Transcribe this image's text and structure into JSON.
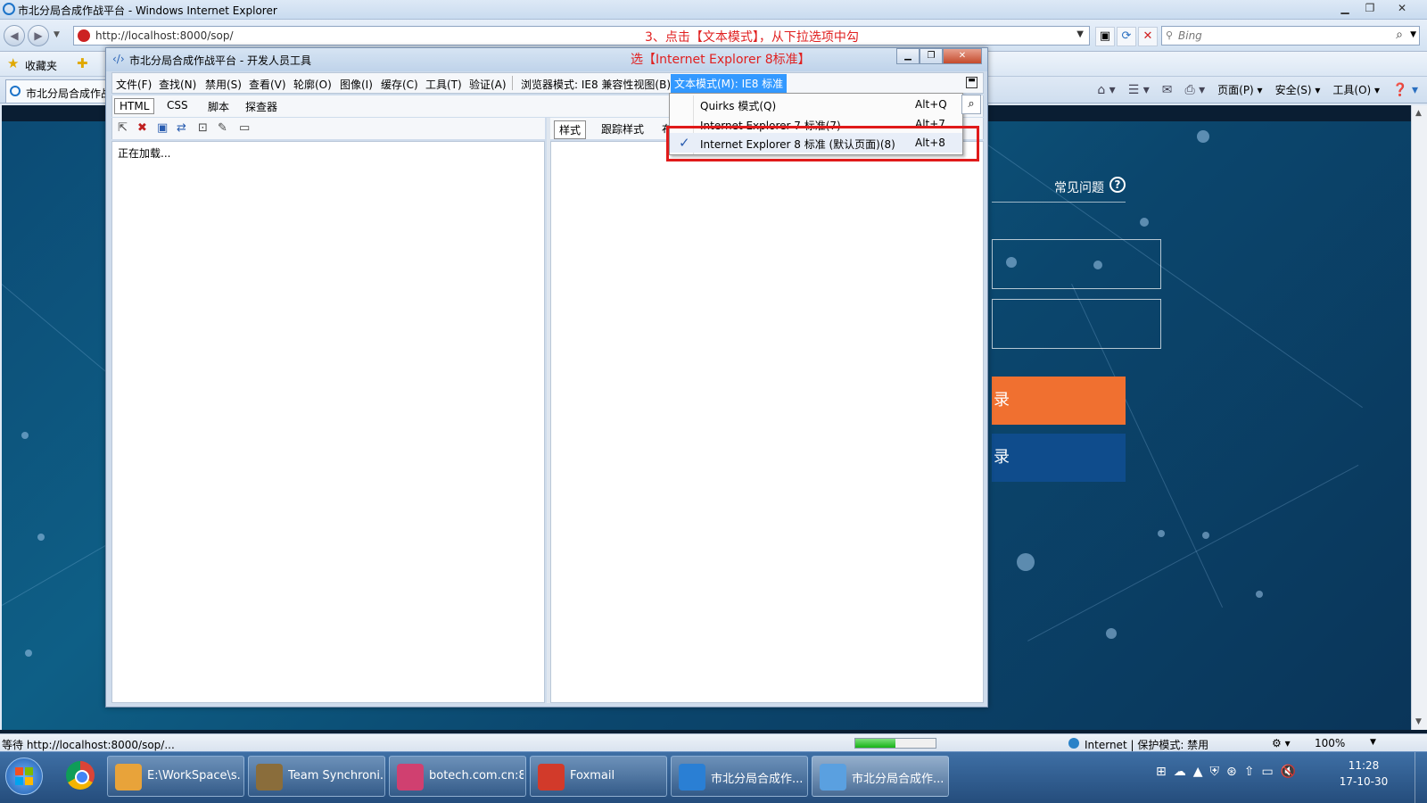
{
  "ie": {
    "window_title": "市北分局合成作战平台 - Windows Internet Explorer",
    "url": "http://localhost:8000/sop/",
    "search_placeholder": "Bing",
    "favorites_label": "收藏夹",
    "tab_label": "市北分局合成作战平台",
    "commands": [
      "页面(P) ▾",
      "安全(S) ▾",
      "工具(O) ▾"
    ],
    "status_text": "等待 http://localhost:8000/sop/...",
    "progress_percent": 50,
    "zone_text": "Internet | 保护模式: 禁用",
    "zoom": "100%"
  },
  "annotations": {
    "step_line1": "3、点击【文本模式】，从下拉选项中勾",
    "step_line2": "选【Internet Explorer 8标准】"
  },
  "page": {
    "faq": "常见问题",
    "login_btn1": "录",
    "login_btn2": "录"
  },
  "devtools": {
    "title": "市北分局合成作战平台 - 开发人员工具",
    "menu": [
      "文件(F)",
      "查找(N)",
      "禁用(S)",
      "查看(V)",
      "轮廓(O)",
      "图像(I)",
      "缓存(C)",
      "工具(T)",
      "验证(A)",
      "浏览器模式: IE8 兼容性视图(B)"
    ],
    "text_mode_menu": "文本模式(M): IE8 标准",
    "tabs": [
      "HTML",
      "CSS",
      "脚本",
      "探查器"
    ],
    "loading": "正在加载...",
    "right_tabs": [
      "样式",
      "跟踪样式",
      "布"
    ],
    "dropdown": [
      {
        "label": "Quirks 模式(Q)",
        "shortcut": "Alt+Q",
        "checked": false
      },
      {
        "label": "Internet Explorer 7 标准(7)",
        "shortcut": "Alt+7",
        "checked": false
      },
      {
        "label": "Internet Explorer 8 标准 (默认页面)(8)",
        "shortcut": "Alt+8",
        "checked": true
      }
    ]
  },
  "taskbar": {
    "items": [
      {
        "label": "E:\\WorkSpace\\s...",
        "color": "#e8a33a"
      },
      {
        "label": "Team Synchroni...",
        "color": "#8a6d3b"
      },
      {
        "label": "botech.com.cn:8...",
        "color": "#d04070"
      },
      {
        "label": "Foxmail",
        "color": "#d23a2a"
      },
      {
        "label": "市北分局合成作...",
        "color": "#2a7fd4"
      },
      {
        "label": "市北分局合成作...",
        "color": "#5aa0e0"
      }
    ],
    "time": "11:28",
    "date": "17-10-30"
  }
}
